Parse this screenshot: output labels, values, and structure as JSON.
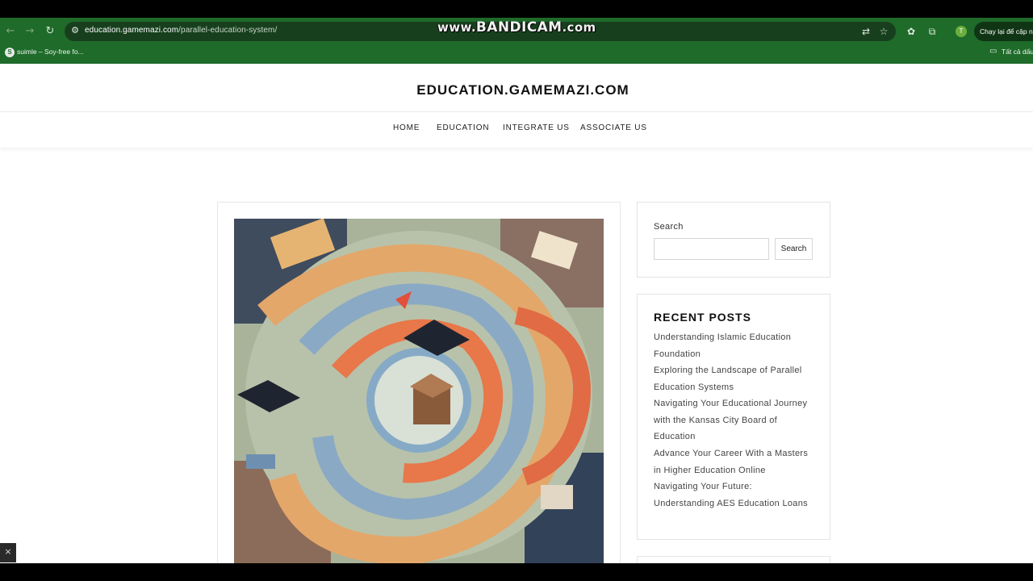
{
  "browser": {
    "url_host": "education.gamemazi.com",
    "url_path": "/parallel-education-system/",
    "watermark_prefix": "www.",
    "watermark_main": "BANDICAM",
    "watermark_suffix": ".com",
    "profile_initial": "T",
    "resume_button": "Chạy lại để cập nh",
    "bookmark": "suimle – Soy-free fo...",
    "bookmark_icon": "S",
    "all_bookmarks": "Tất cả dấu",
    "icons": {
      "back": "←",
      "forward": "→",
      "reload": "↻",
      "site_info": "⚙",
      "translate": "⇄",
      "star": "☆",
      "extension_a": "✿",
      "extension_b": "⧉",
      "folder": "▭"
    }
  },
  "site": {
    "title": "EDUCATION.GAMEMAZI.COM",
    "nav": [
      "HOME",
      "EDUCATION",
      "INTEGRATE US",
      "ASSOCIATE US"
    ]
  },
  "sidebar": {
    "search": {
      "label": "Search",
      "placeholder": "",
      "button": "Search"
    },
    "recent_posts": {
      "heading": "RECENT POSTS",
      "items": [
        "Understanding Islamic Education Foundation",
        "Exploring the Landscape of Parallel Education Systems",
        "Navigating Your Educational Journey with the Kansas City Board of Education",
        "Advance Your Career With a Masters in Higher Education Online",
        "Navigating Your Future: Understanding AES Education Loans"
      ]
    }
  },
  "overlay": {
    "close": "×"
  }
}
